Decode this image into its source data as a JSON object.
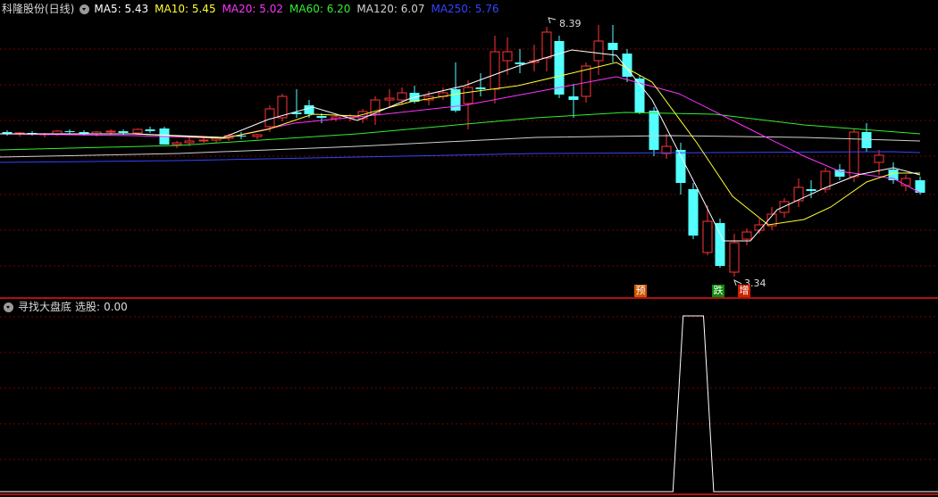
{
  "main": {
    "title": "科隆股份(日线)",
    "ma_legend": [
      {
        "label": "MA5:",
        "value": "5.43",
        "color": "#ffffff"
      },
      {
        "label": "MA10:",
        "value": "5.45",
        "color": "#ffff33"
      },
      {
        "label": "MA20:",
        "value": "5.02",
        "color": "#ff33ff"
      },
      {
        "label": "MA60:",
        "value": "6.20",
        "color": "#33ee33"
      },
      {
        "label": "MA120:",
        "value": "6.07",
        "color": "#d0d0d0"
      },
      {
        "label": "MA250:",
        "value": "5.76",
        "color": "#3344ff"
      }
    ],
    "high_marker": "8.39",
    "low_marker": "3.34",
    "signals": [
      {
        "text": "预",
        "bg": "#cc5500"
      },
      {
        "text": "跌",
        "bg": "#0a8a0a"
      },
      {
        "text": "增",
        "bg": "#cc2200"
      }
    ]
  },
  "indicator": {
    "title": "寻找大盘底",
    "output_label": "选股:",
    "output_value": "0.00",
    "values": [
      0,
      0,
      0,
      0,
      0,
      0,
      0,
      0,
      0,
      0,
      0,
      0,
      0,
      0,
      0,
      0,
      0,
      0,
      0,
      0,
      0,
      0,
      0,
      0,
      0,
      0,
      0,
      0,
      0,
      0,
      0,
      0,
      0,
      0,
      0,
      0,
      0,
      0,
      0,
      0,
      0,
      0,
      0,
      0,
      0,
      0,
      0,
      0,
      0,
      0,
      0,
      0,
      0,
      0,
      0,
      0,
      0,
      0,
      0,
      0,
      0,
      0,
      0,
      0,
      0,
      0,
      0,
      1,
      1,
      1,
      0,
      0,
      0,
      0,
      0,
      0,
      0,
      0,
      0,
      0,
      0,
      0,
      0,
      0,
      0,
      0,
      0,
      0,
      0,
      0,
      0,
      0,
      0
    ]
  },
  "colors": {
    "up": "#ff3333",
    "down": "#54ffff",
    "grid": "#7a0000",
    "axis": "#b01010"
  }
}
